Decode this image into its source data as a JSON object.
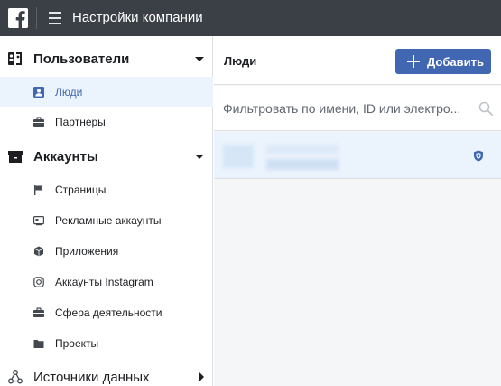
{
  "header": {
    "title": "Настройки компании"
  },
  "sidebar": {
    "users_section": {
      "title": "Пользователи",
      "items": [
        {
          "label": "Люди",
          "active": true
        },
        {
          "label": "Партнеры",
          "active": false
        }
      ]
    },
    "accounts_section": {
      "title": "Аккаунты",
      "items": [
        {
          "label": "Страницы"
        },
        {
          "label": "Рекламные аккаунты"
        },
        {
          "label": "Приложения"
        },
        {
          "label": "Аккаунты Instagram"
        },
        {
          "label": "Сфера деятельности"
        },
        {
          "label": "Проекты"
        }
      ]
    },
    "data_sources_section": {
      "title": "Источники данных"
    }
  },
  "main": {
    "title": "Люди",
    "add_button_label": "Добавить",
    "search_placeholder": "Фильтровать по имени, ID или электро..."
  },
  "colors": {
    "accent": "#4267b2",
    "topbar": "#3b3f46",
    "active_bg": "#ebf3fd"
  }
}
